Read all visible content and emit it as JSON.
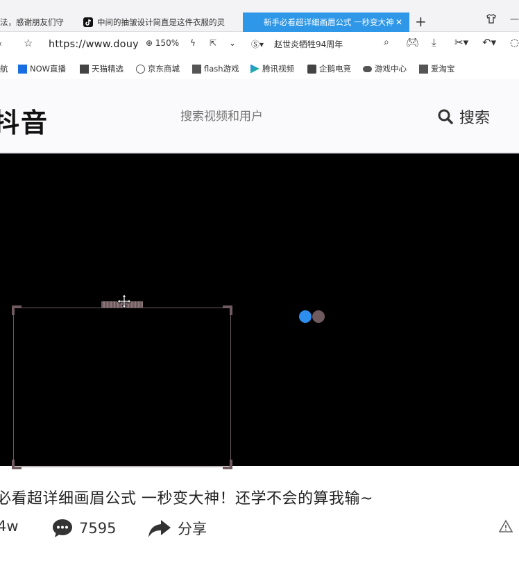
{
  "browser": {
    "tabs": [
      {
        "label": "法，感谢朋友们守"
      },
      {
        "label": "中间的抽皱设计简直是这件衣服的灵"
      },
      {
        "label": "新手必看超详细画眉公式 一秒变大神"
      }
    ],
    "new_tab_label": "+",
    "url": "https://www.douy",
    "zoom": "150%",
    "news_item": "赵世炎牺牲94周年"
  },
  "bookmarks": [
    {
      "label": "航"
    },
    {
      "label": "NOW直播"
    },
    {
      "label": "天猫精选"
    },
    {
      "label": "京东商城"
    },
    {
      "label": "flash游戏"
    },
    {
      "label": "腾讯视频"
    },
    {
      "label": "企鹅电竞"
    },
    {
      "label": "游戏中心"
    },
    {
      "label": "爱淘宝"
    }
  ],
  "site": {
    "logo": "抖音",
    "search_placeholder": "搜索视频和用户",
    "search_button": "搜索"
  },
  "video": {
    "title": "必看超详细画眉公式 一秒变大神！还学不会的算我输~",
    "likes": "4w",
    "comments": "7595",
    "share": "分享"
  },
  "colors": {
    "active_tab": "#2e97e8",
    "loader_dot_1": "#2d8ef0",
    "loader_dot_2": "#6e5a5f",
    "selection_frame": "#6e5a5f"
  }
}
